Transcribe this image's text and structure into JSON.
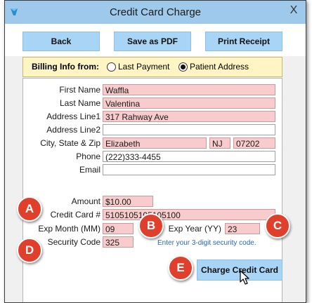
{
  "window": {
    "title": "Credit Card Charge",
    "close_glyph": "X"
  },
  "toolbar": {
    "back": "Back",
    "save_pdf": "Save as PDF",
    "print_receipt": "Print Receipt"
  },
  "billing": {
    "label": "Billing Info from:",
    "option_last": "Last Payment",
    "option_patient": "Patient Address",
    "selected": "Patient Address"
  },
  "form": {
    "first_name_label": "First Name",
    "first_name": "Waffla",
    "last_name_label": "Last Name",
    "last_name": "Valentina",
    "address1_label": "Address Line1",
    "address1": "317 Rahway Ave",
    "address2_label": "Address Line2",
    "address2": "",
    "csz_label": "City, State & Zip",
    "city": "Elizabeth",
    "state": "NJ",
    "zip": "07202",
    "phone_label": "Phone",
    "phone": "(222)333-4455",
    "email_label": "Email",
    "email": "",
    "amount_label": "Amount",
    "amount": "$10.00",
    "card_label": "Credit Card #",
    "card": "5105105105105100",
    "exp_month_label": "Exp Month (MM)",
    "exp_month": "09",
    "exp_year_label": "Exp Year (YY)",
    "exp_year": "23",
    "security_label": "Security Code",
    "security": "325",
    "security_hint": "Enter your 3-digit security code."
  },
  "actions": {
    "charge": "Charge Credit Card"
  },
  "callouts": {
    "a": "A",
    "b": "B",
    "c": "C",
    "d": "D",
    "e": "E"
  },
  "colors": {
    "title_bar": "#9ec9ea",
    "button": "#a8d4f5",
    "required_field": "#f8cccc",
    "billing_bar": "#fff5c4",
    "callout": "#e0402b",
    "hint": "#2b66b0"
  },
  "icons": {
    "app": "app-icon",
    "close": "close-icon",
    "cursor": "pointer-cursor-icon"
  }
}
